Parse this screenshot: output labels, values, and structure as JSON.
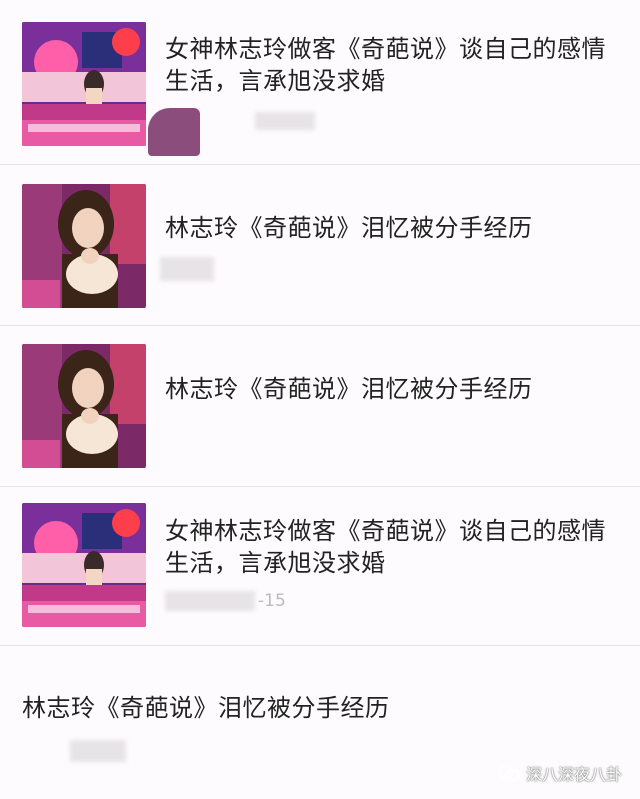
{
  "articles": [
    {
      "title": "女神林志玲做客《奇葩说》谈自己的感情生活，言承旭没求婚",
      "meta": "",
      "thumb": "studio-wide"
    },
    {
      "title": "林志玲《奇葩说》泪忆被分手经历",
      "meta": "",
      "thumb": "closeup"
    },
    {
      "title": "林志玲《奇葩说》泪忆被分手经历",
      "meta": "",
      "thumb": "closeup"
    },
    {
      "title": "女神林志玲做客《奇葩说》谈自己的感情生活，言承旭没求婚",
      "meta": "-15",
      "thumb": "studio-wide"
    },
    {
      "title": "林志玲《奇葩说》泪忆被分手经历",
      "meta": ""
    }
  ],
  "watermark": {
    "text": "深八深夜八卦",
    "icon": "wechat-icon"
  },
  "colors": {
    "background": "#fdfbfd",
    "divider": "#e6e3e6",
    "title": "#222222"
  }
}
